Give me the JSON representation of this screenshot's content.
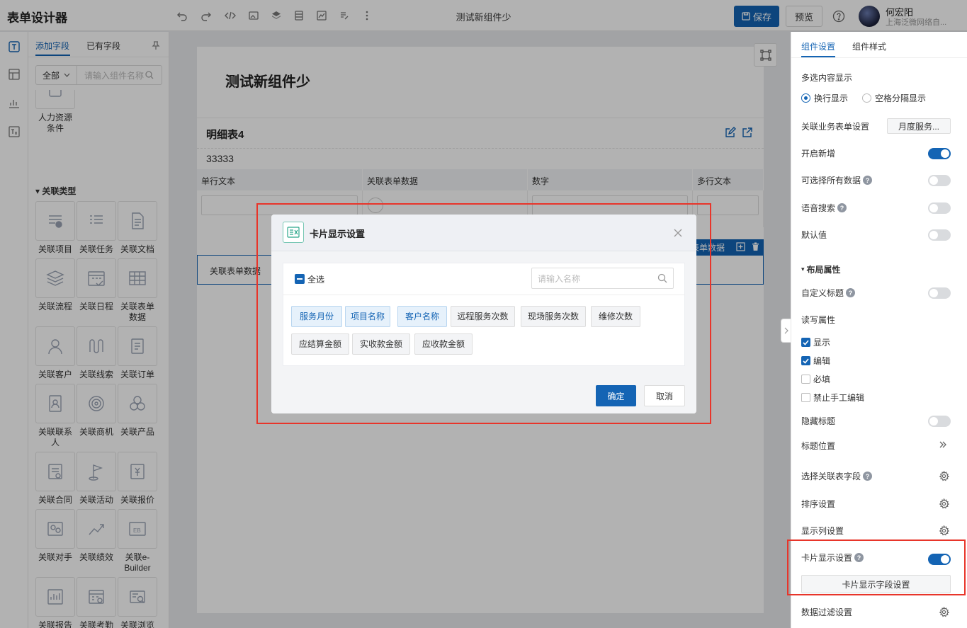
{
  "header": {
    "app_title": "表单设计器",
    "doc_title": "测试新组件少",
    "save_label": "保存",
    "preview_label": "预览",
    "user_name": "何宏阳",
    "user_org": "上海泛微网络自..."
  },
  "left_panel": {
    "tab_add": "添加字段",
    "tab_existing": "已有字段",
    "filter_value": "全部",
    "search_placeholder": "请输入组件名称",
    "top_item_label": "人力资源条件",
    "category_label": "关联类型",
    "items": [
      {
        "label": "关联项目",
        "icon": "project-icon"
      },
      {
        "label": "关联任务",
        "icon": "task-icon"
      },
      {
        "label": "关联文档",
        "icon": "document-icon"
      },
      {
        "label": "关联流程",
        "icon": "workflow-icon"
      },
      {
        "label": "关联日程",
        "icon": "calendar-icon"
      },
      {
        "label": "关联表单数据",
        "icon": "table-icon"
      },
      {
        "label": "关联客户",
        "icon": "customer-icon"
      },
      {
        "label": "关联线索",
        "icon": "lead-icon"
      },
      {
        "label": "关联订单",
        "icon": "order-icon"
      },
      {
        "label": "关联联系人",
        "icon": "contact-icon"
      },
      {
        "label": "关联商机",
        "icon": "target-icon"
      },
      {
        "label": "关联产品",
        "icon": "product-icon"
      },
      {
        "label": "关联合同",
        "icon": "contract-icon"
      },
      {
        "label": "关联活动",
        "icon": "flag-icon"
      },
      {
        "label": "关联报价",
        "icon": "quote-icon"
      },
      {
        "label": "关联对手",
        "icon": "competitor-icon"
      },
      {
        "label": "关联绩效",
        "icon": "trend-icon"
      },
      {
        "label": "关联e-Builder",
        "icon": "eb-icon"
      },
      {
        "label": "关联报告",
        "icon": "report-icon"
      },
      {
        "label": "关联考勤",
        "icon": "attendance-icon"
      },
      {
        "label": "关联浏览",
        "icon": "browse-icon"
      }
    ]
  },
  "canvas": {
    "form_title": "测试新组件少",
    "detail_title": "明细表4",
    "detail_number": "33333",
    "columns": [
      "单行文本",
      "关联表单数据",
      "数字",
      "多行文本"
    ],
    "selected_bar_label": "表单数据",
    "selected_field_label": "关联表单数据"
  },
  "modal": {
    "title": "卡片显示设置",
    "check_all_label": "全选",
    "search_placeholder": "请输入名称",
    "chips": [
      {
        "label": "服务月份",
        "selected": true
      },
      {
        "label": "项目名称",
        "selected": true
      },
      {
        "label": "客户名称",
        "selected": true
      },
      {
        "label": "远程服务次数",
        "selected": false
      },
      {
        "label": "现场服务次数",
        "selected": false
      },
      {
        "label": "维修次数",
        "selected": false
      },
      {
        "label": "应结算金额",
        "selected": false
      },
      {
        "label": "实收款金额",
        "selected": false
      },
      {
        "label": "应收款金额",
        "selected": false
      }
    ],
    "ok_label": "确定",
    "cancel_label": "取消"
  },
  "right_panel": {
    "tab_component": "组件设置",
    "tab_style": "组件样式",
    "multi_display_label": "多选内容显示",
    "radio_newline": "换行显示",
    "radio_space": "空格分隔显示",
    "radio_selected": "换行显示",
    "relate_form_label": "关联业务表单设置",
    "relate_form_value": "月度服务...",
    "enable_add_label": "开启新增",
    "enable_add_on": true,
    "select_all_data_label": "可选择所有数据",
    "select_all_data_on": false,
    "voice_search_label": "语音搜索",
    "voice_search_on": false,
    "default_label": "默认值",
    "default_on": false,
    "layout_section_label": "布局属性",
    "custom_title_label": "自定义标题",
    "custom_title_on": false,
    "rw_label": "读写属性",
    "cb_show": "显示",
    "cb_show_on": true,
    "cb_edit": "编辑",
    "cb_edit_on": true,
    "cb_required": "必填",
    "cb_required_on": false,
    "cb_no_manual": "禁止手工编辑",
    "cb_no_manual_on": false,
    "hide_title_label": "隐藏标题",
    "hide_title_on": false,
    "title_pos_label": "标题位置",
    "select_fields_label": "选择关联表字段",
    "sort_label": "排序设置",
    "columns_label": "显示列设置",
    "card_display_label": "卡片显示设置",
    "card_display_on": true,
    "card_field_btn": "卡片显示字段设置",
    "filter_label": "数据过滤设置"
  },
  "colors": {
    "accent": "#1464b4",
    "highlight": "#e8352a",
    "toggle_off": "#d9dbde"
  }
}
